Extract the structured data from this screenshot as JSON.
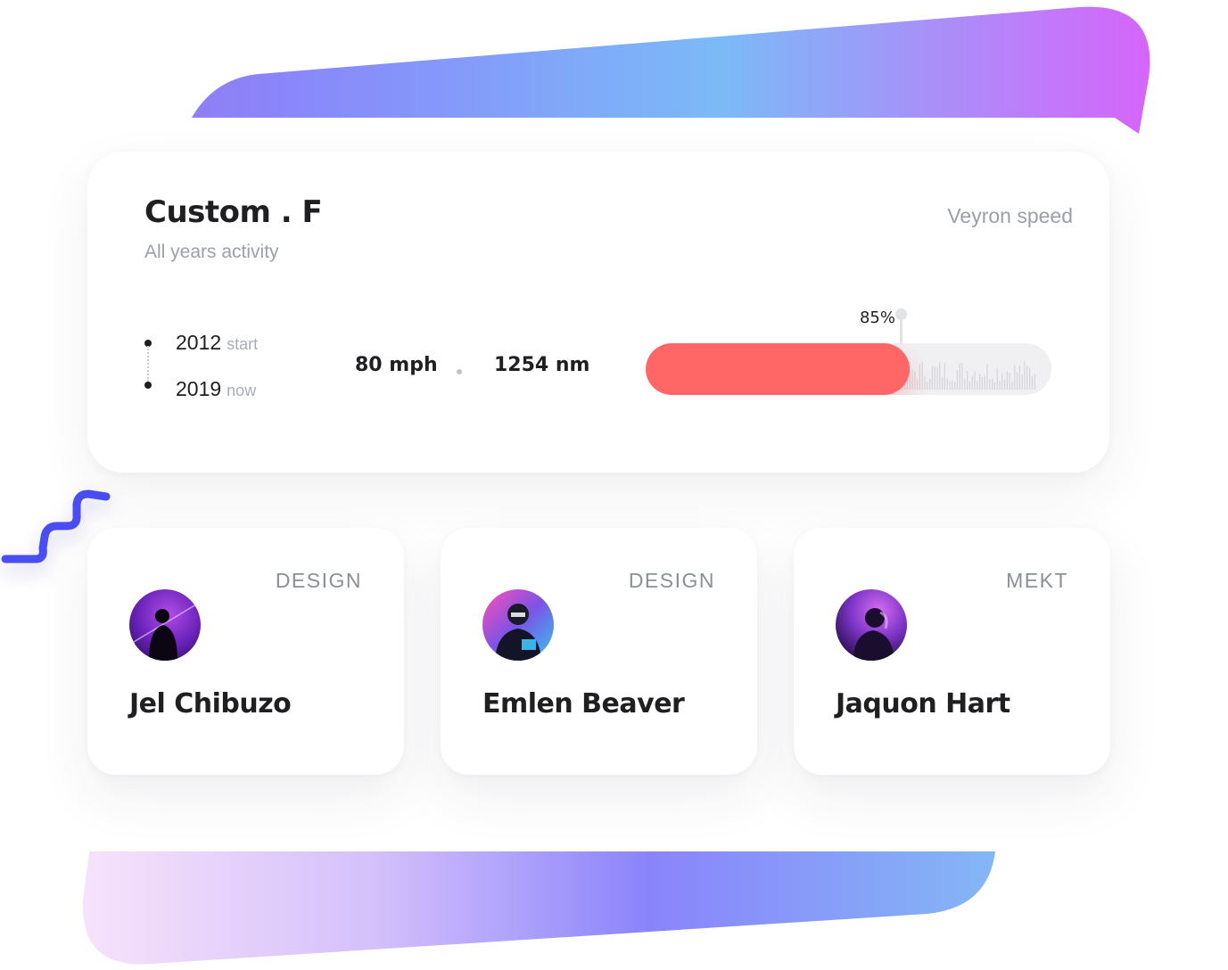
{
  "colors": {
    "accent_red": "#ff6767",
    "gradient_top": [
      "#8a7ff7",
      "#7ab8f8",
      "#d56bf9"
    ],
    "gradient_bottom": [
      "#f3d9fb",
      "#8a84fb",
      "#82b3f6"
    ],
    "squiggle": "#4b4df0"
  },
  "card": {
    "title": "Custom . F",
    "subtitle": "All years activity",
    "speed_label": "Veyron speed",
    "timeline": [
      {
        "year": "2012",
        "tag": "start"
      },
      {
        "year": "2019",
        "tag": "now"
      }
    ],
    "stats": {
      "speed": "80 mph",
      "distance": "1254 nm"
    },
    "progress": {
      "value": 0.65,
      "label": "85%"
    }
  },
  "people": [
    {
      "name": "Jel Chibuzo",
      "role": "DESIGN",
      "avatar": "avatar-photo"
    },
    {
      "name": "Emlen Beaver",
      "role": "DESIGN",
      "avatar": "avatar-photo"
    },
    {
      "name": "Jaquon Hart",
      "role": "MEKT",
      "avatar": "avatar-photo"
    }
  ]
}
